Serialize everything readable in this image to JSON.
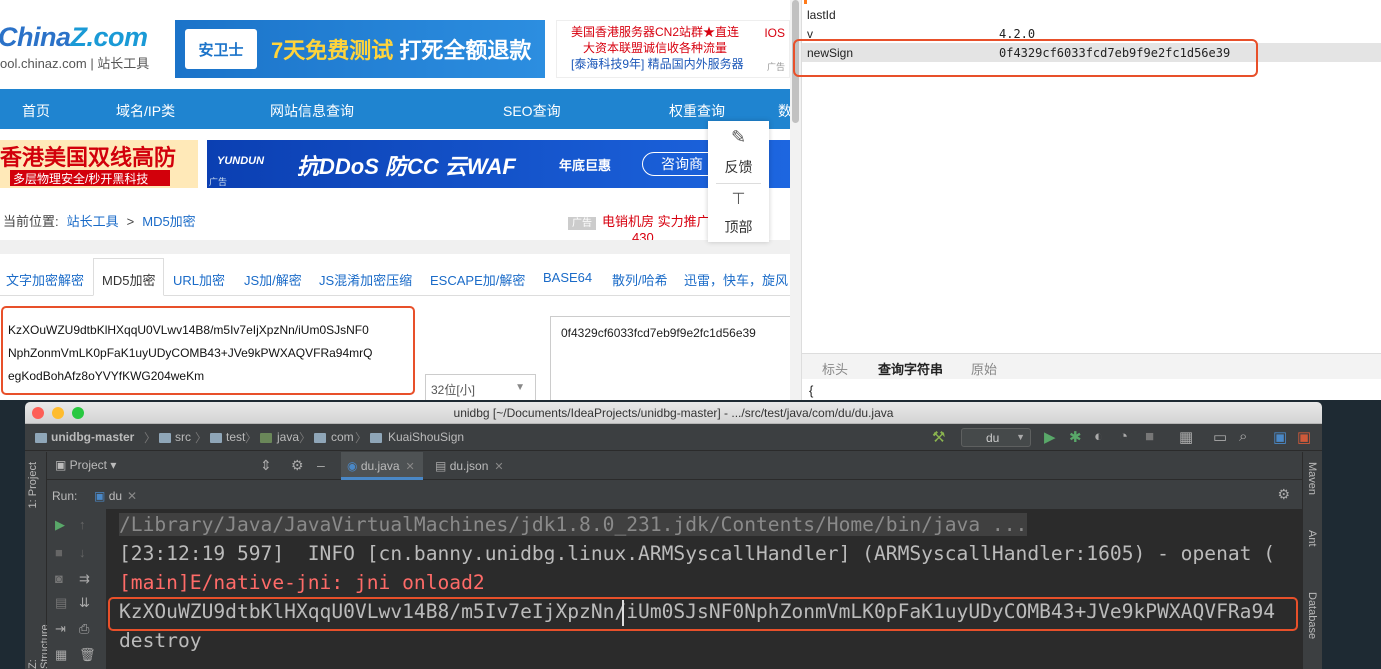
{
  "web": {
    "logo_main": "China",
    "logo_accent": "Z.com",
    "logo_sub": "ool.chinaz.com | 站长工具",
    "ad1": {
      "badge": "安卫士",
      "text_prefix": "7天免费测试",
      "text_main": " 打死全额退款"
    },
    "ad2": {
      "line1": "美国香港服务器CN2站群★直连",
      "line2": "大资本联盟诚信收各种流量",
      "line3": "[泰海科技9年] 精品国内外服务器",
      "right_top": "IOS",
      "right_mark": "★",
      "tag": "广告"
    },
    "nav": [
      "首页",
      "域名/IP类",
      "网站信息查询",
      "SEO查询",
      "权重查询",
      "数"
    ],
    "banner_left": {
      "title": "香港美国双线高防",
      "sub": "多层物理安全/秒开黑科技"
    },
    "banner_right": {
      "brand": "YUNDUN",
      "main": "抗DDoS 防CC 云WAF",
      "sub": "年底巨惠",
      "button": "咨询商",
      "tag": "广告"
    },
    "breadcrumb": {
      "prefix": "当前位置:",
      "link1": "站长工具",
      "sep": ">",
      "link2": "MD5加密"
    },
    "promo": {
      "tag": "广告",
      "text": "电销机房 实力推广",
      "tail": "430"
    },
    "side_tools": {
      "feedback": "反馈",
      "top": "顶部"
    },
    "tabs": [
      "文字加密解密",
      "MD5加密",
      "URL加密",
      "JS加/解密",
      "JS混淆加密压缩",
      "ESCAPE加/解密",
      "BASE64",
      "散列/哈希",
      "迅雷，快车，旋风"
    ],
    "input_lines": [
      "KzXOuWZU9dtbKlHXqqU0VLwv14B8/m5Iv7eIjXpzNn/iUm0SJsNF0",
      "NphZonmVmLK0pFaK1uyUDyCOMB43+JVe9kPWXAQVFRa94mrQ",
      "egKodBohAfz8oYVYfKWG204weKm"
    ],
    "select_value": "32位[小]",
    "output_value": "0f4329cf6033fcd7eb9f9e2fc1d56e39"
  },
  "inspector": {
    "rows": [
      {
        "key": "lastId",
        "value": ""
      },
      {
        "key": "v",
        "value": "4.2.0"
      },
      {
        "key": "newSign",
        "value": "0f4329cf6033fcd7eb9f9e2fc1d56e39"
      }
    ],
    "tabs": [
      "标头",
      "查询字符串",
      "原始"
    ],
    "brace": "{"
  },
  "ide": {
    "title": "unidbg [~/Documents/IdeaProjects/unidbg-master] - .../src/test/java/com/du/du.java",
    "breadcrumbs": [
      "unidbg-master",
      "src",
      "test",
      "java",
      "com",
      "KuaiShouSign"
    ],
    "run_config": "du",
    "project_label": "Project",
    "editor_tabs": [
      "du.java",
      "du.json"
    ],
    "run_label": "Run:",
    "run_tab": "du",
    "left_tools": [
      "1: Project",
      "Z: Structure"
    ],
    "right_tools": [
      "Maven",
      "Ant",
      "Database"
    ],
    "console": [
      "/Library/Java/JavaVirtualMachines/jdk1.8.0_231.jdk/Contents/Home/bin/java ...",
      "[23:12:19 597]  INFO [cn.banny.unidbg.linux.ARMSyscallHandler] (ARMSyscallHandler:1605) - openat (",
      "[main]E/native-jni: jni onload2",
      "KzXOuWZU9dtbKlHXqqU0VLwv14B8/m5Iv7eIjXpzNn/iUm0SJsNF0NphZonmVmLK0pFaK1uyUDyCOMB43+JVe9kPWXAQVFRa94",
      "destroy"
    ]
  },
  "colors": {
    "highlight": "#e8502a",
    "nav_blue": "#1f84d0",
    "console_bg": "#2b2b2b",
    "error_red": "#ff6b68"
  }
}
